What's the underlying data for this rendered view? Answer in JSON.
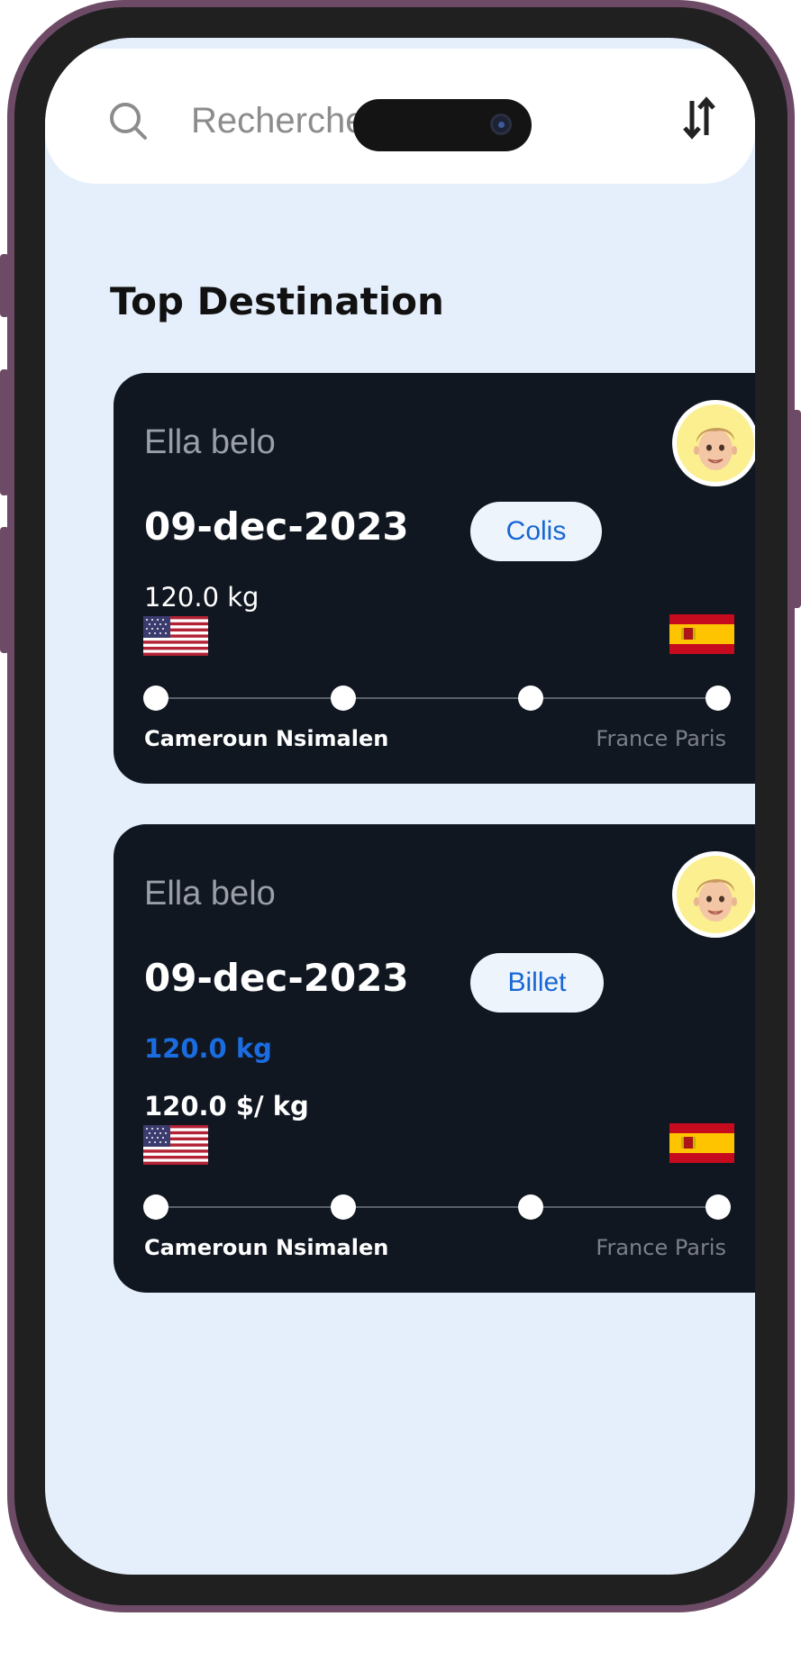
{
  "search": {
    "placeholder": "Recherche"
  },
  "section": {
    "title": "Top Destination"
  },
  "cards": [
    {
      "traveler": "Ella belo",
      "date": "09-dec-2023",
      "type": "Colis",
      "weight": "120.0  kg",
      "origin_flag": "usa-flag",
      "destination_flag": "spain-flag",
      "route_stops": 4,
      "origin": "Cameroun Nsimalen",
      "destination": "France Paris"
    },
    {
      "traveler": "Ella belo",
      "date": "09-dec-2023",
      "type": "Billet",
      "weight": "120.0  kg",
      "price": "120.0 $/ kg",
      "origin_flag": "usa-flag",
      "destination_flag": "spain-flag",
      "route_stops": 4,
      "origin": "Cameroun Nsimalen",
      "destination": "France Paris"
    }
  ],
  "colors": {
    "background": "#e5effc",
    "card": "#111721",
    "accent": "#1767d4",
    "pill": "#eef4fc",
    "frame": "#6d4b66"
  }
}
